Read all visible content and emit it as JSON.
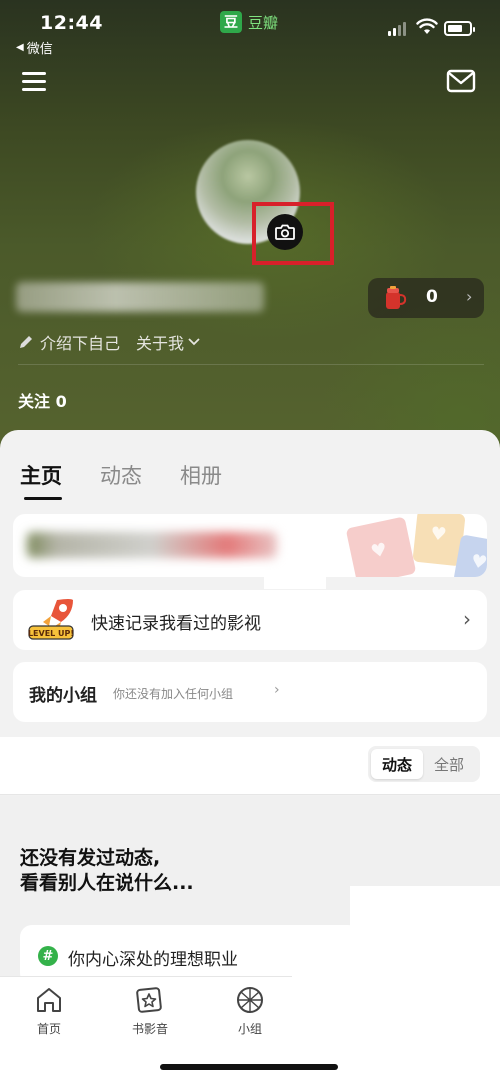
{
  "status_bar": {
    "time": "12:44",
    "back_app": "微信",
    "app_name": "豆瓣",
    "app_logo_char": "豆"
  },
  "profile": {
    "score": "0",
    "intro_label": "介绍下自己",
    "about_label": "关于我",
    "following": "关注 0"
  },
  "tabs": [
    {
      "label": "主页",
      "active": true
    },
    {
      "label": "动态",
      "active": false
    },
    {
      "label": "相册",
      "active": false
    }
  ],
  "cards": {
    "record_label": "快速记录我看过的影视",
    "rocket_badge": "LEVEL UP!",
    "group_title": "我的小组",
    "group_sub": "你还没有加入任何小组"
  },
  "filter": {
    "active": "动态",
    "inactive": "全部"
  },
  "feed": {
    "empty_line1": "还没有发过动态,",
    "empty_line2": "看看别人在说什么...",
    "topic": "你内心深处的理想职业"
  },
  "tabbar": [
    {
      "label": "首页",
      "icon": "home-icon"
    },
    {
      "label": "书影音",
      "icon": "star-card-icon"
    },
    {
      "label": "小组",
      "icon": "group-ball-icon"
    }
  ],
  "colors": {
    "highlight": "#d8202a",
    "douban_green": "#2fa84a",
    "topic_green": "#34b24a"
  }
}
